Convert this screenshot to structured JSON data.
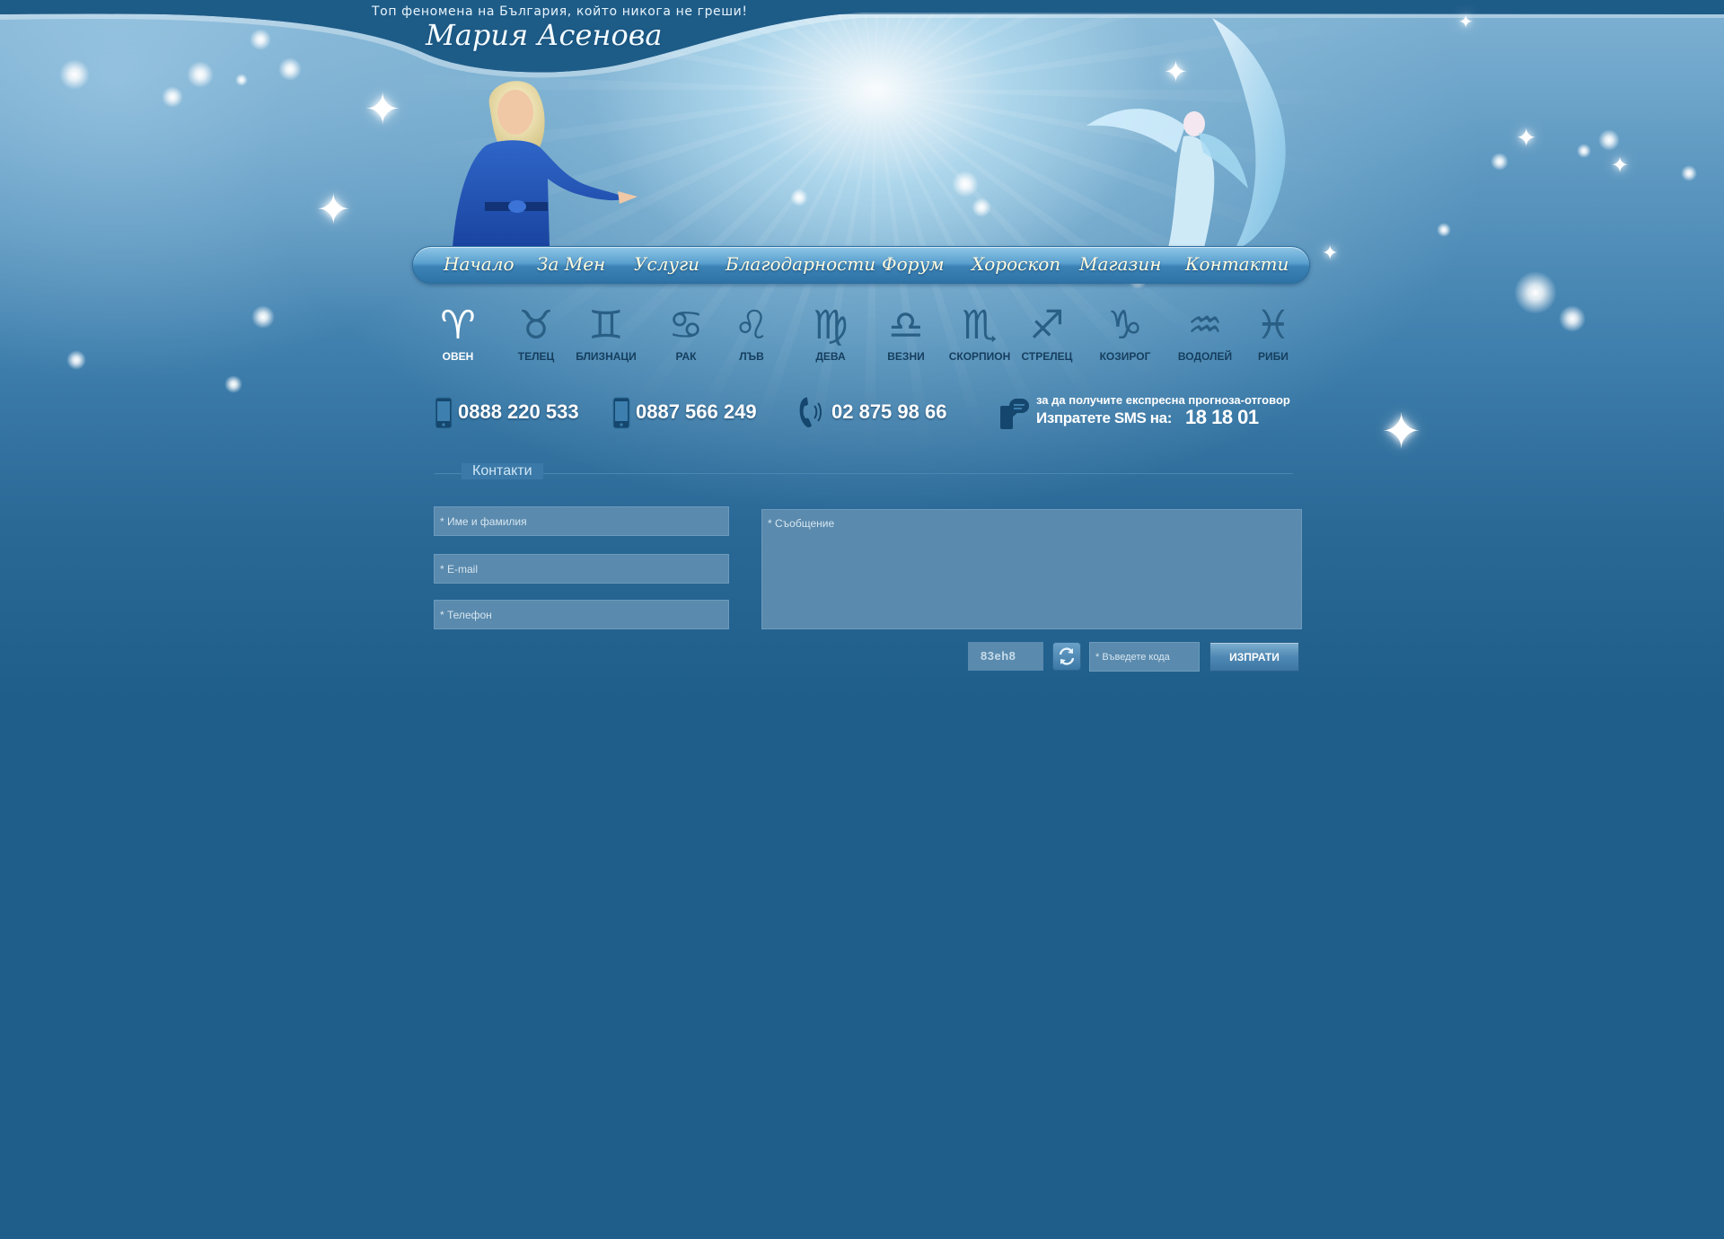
{
  "header": {
    "tagline": "Топ феномена на България, който никога не греши!",
    "logo": "Мария Асенова"
  },
  "nav": {
    "items": [
      {
        "label": "Начало"
      },
      {
        "label": "За Мен"
      },
      {
        "label": "Услуги"
      },
      {
        "label": "Благодарности"
      },
      {
        "label": "Форум"
      },
      {
        "label": "Хороскоп"
      },
      {
        "label": "Магазин"
      },
      {
        "label": "Контакти"
      }
    ]
  },
  "zodiac": {
    "active": "ОВЕН",
    "signs": [
      {
        "label": "ОВЕН",
        "glyph": "♈︎",
        "icon": "aries-icon"
      },
      {
        "label": "ТЕЛЕЦ",
        "glyph": "♉︎",
        "icon": "taurus-icon"
      },
      {
        "label": "БЛИЗНАЦИ",
        "glyph": "♊︎",
        "icon": "gemini-icon"
      },
      {
        "label": "РАК",
        "glyph": "♋︎",
        "icon": "cancer-icon"
      },
      {
        "label": "ЛЪВ",
        "glyph": "♌︎",
        "icon": "leo-icon"
      },
      {
        "label": "ДЕВА",
        "glyph": "♍︎",
        "icon": "virgo-icon"
      },
      {
        "label": "ВЕЗНИ",
        "glyph": "♎︎",
        "icon": "libra-icon"
      },
      {
        "label": "СКОРПИОН",
        "glyph": "♏︎",
        "icon": "scorpio-icon"
      },
      {
        "label": "СТРЕЛЕЦ",
        "glyph": "♐︎",
        "icon": "sagittarius-icon"
      },
      {
        "label": "КОЗИРОГ",
        "glyph": "♑︎",
        "icon": "capricorn-icon"
      },
      {
        "label": "ВОДОЛЕЙ",
        "glyph": "♒︎",
        "icon": "aquarius-icon"
      },
      {
        "label": "РИБИ",
        "glyph": "♓︎",
        "icon": "pisces-icon"
      }
    ]
  },
  "phones": [
    {
      "number": "0888 220 533",
      "icon": "mobile-phone-icon"
    },
    {
      "number": "0887 566 249",
      "icon": "mobile-phone-icon"
    },
    {
      "number": "02 875 98 66",
      "icon": "landline-phone-icon"
    }
  ],
  "sms": {
    "line1": "за да получите  експресна прогноза-отговор",
    "line2": "Изпратете SMS на:",
    "number": "18 18 01",
    "icon": "sms-chat-icon"
  },
  "contact": {
    "title": "Контакти",
    "name_placeholder": "* Име и фамилия",
    "email_placeholder": "* E-mail",
    "phone_placeholder": "* Телефон",
    "message_placeholder": "* Съобщение",
    "captcha_text": "83eh8",
    "code_placeholder": "* Въведете кода",
    "submit_label": "ИЗПРАТИ"
  },
  "colors": {
    "background": "#1f5e8b",
    "nav_text": "#fffbe0",
    "active_sign": "#ffffff",
    "inactive_sign": "#2a5f85"
  }
}
